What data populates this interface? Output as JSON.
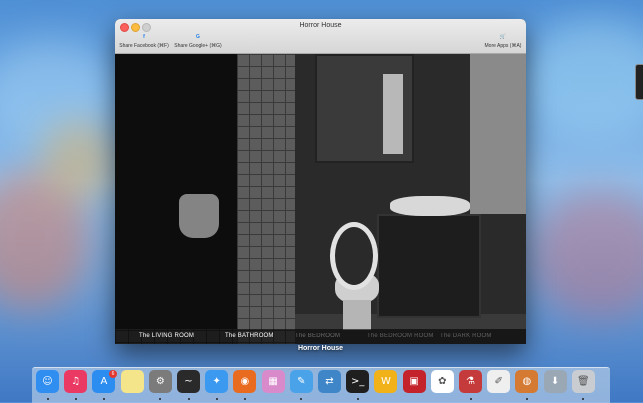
{
  "window": {
    "title": "Horror House"
  },
  "toolbar": {
    "share_facebook": "Share Facebook (⌘F)",
    "share_google": "Share Google+ (⌘G)",
    "more_apps": "More Apps (⌘A)",
    "facebook_glyph": "f",
    "google_glyph": "G",
    "cart_glyph": "🛒"
  },
  "rooms": [
    "The LIVING ROOM",
    "The BATHROOM",
    "The BEDROOM",
    "The BEDROOM ROOM",
    "The DARK ROOM"
  ],
  "app_label": "Horror House",
  "dock": {
    "items": [
      {
        "name": "finder",
        "glyph": "☺",
        "color": "#2f8ef0"
      },
      {
        "name": "itunes",
        "glyph": "♫",
        "color": "#ea3a63"
      },
      {
        "name": "app-store",
        "glyph": "A",
        "color": "#2c8df0"
      },
      {
        "name": "notes",
        "glyph": "",
        "color": "#f4e48a"
      },
      {
        "name": "system-preferences",
        "glyph": "⚙",
        "color": "#7b7b7b"
      },
      {
        "name": "activity-monitor",
        "glyph": "~",
        "color": "#2a2a2a"
      },
      {
        "name": "safari",
        "glyph": "✦",
        "color": "#3b9af0"
      },
      {
        "name": "firefox",
        "glyph": "◉",
        "color": "#e86b1f"
      },
      {
        "name": "photo-app",
        "glyph": "▦",
        "color": "#d88acb"
      },
      {
        "name": "xcode",
        "glyph": "✎",
        "color": "#4aa3e8"
      },
      {
        "name": "migration",
        "glyph": "⇄",
        "color": "#3f86c9"
      },
      {
        "name": "terminal",
        "glyph": ">_",
        "color": "#1f1f1f"
      },
      {
        "name": "word-game",
        "glyph": "W",
        "color": "#f1b219"
      },
      {
        "name": "photo-booth",
        "glyph": "▣",
        "color": "#c4232b"
      },
      {
        "name": "photos",
        "glyph": "✿",
        "color": "#ffffff"
      },
      {
        "name": "flask-app",
        "glyph": "⚗",
        "color": "#c53b3b"
      },
      {
        "name": "textedit",
        "glyph": "✐",
        "color": "#efefef"
      },
      {
        "name": "pizza-game",
        "glyph": "◍",
        "color": "#d47a33"
      },
      {
        "name": "downloads",
        "glyph": "⬇",
        "color": "#9aa7b5"
      },
      {
        "name": "trash",
        "glyph": "🗑",
        "color": "#c9ccd0"
      }
    ],
    "badge": "6"
  }
}
